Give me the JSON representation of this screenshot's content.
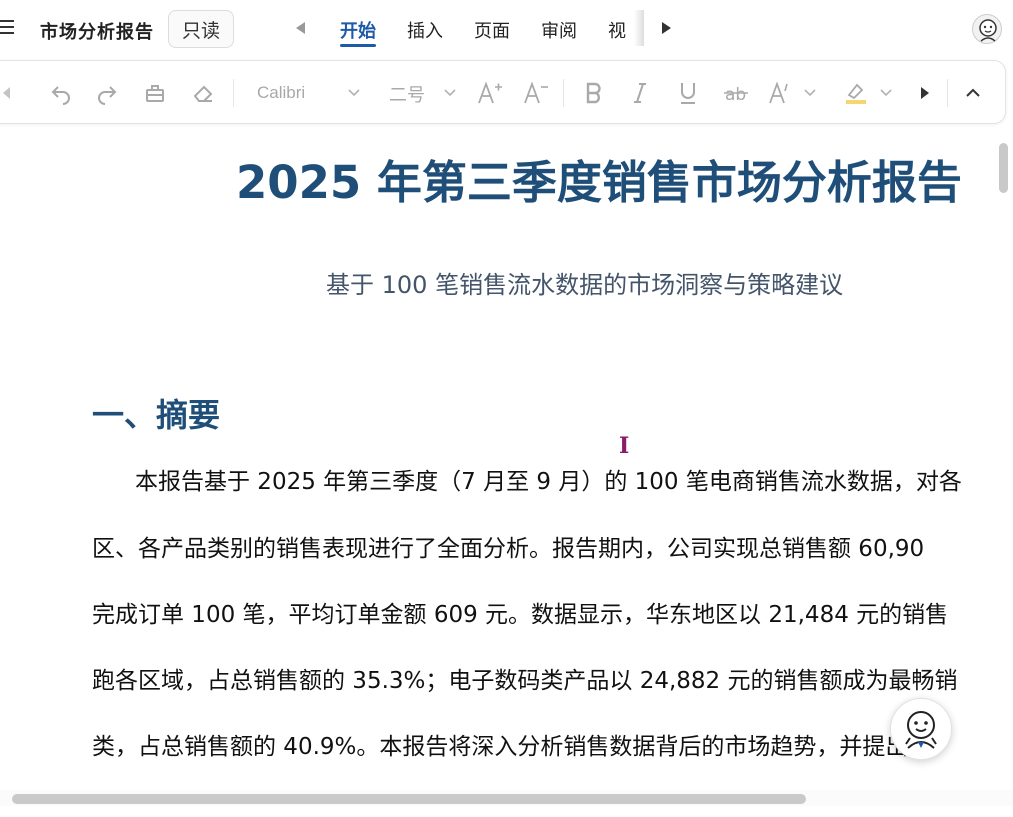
{
  "header": {
    "doc_title": "市场分析报告",
    "readonly_label": "只读",
    "tabs": [
      {
        "label": "开始",
        "active": true
      },
      {
        "label": "插入",
        "active": false
      },
      {
        "label": "页面",
        "active": false
      },
      {
        "label": "审阅",
        "active": false
      },
      {
        "label": "视",
        "active": false
      }
    ]
  },
  "toolbar": {
    "font_name": "Calibri",
    "font_size": "二号",
    "icons": [
      "undo-icon",
      "redo-icon",
      "format-painter-icon",
      "eraser-icon",
      "increase-font-icon",
      "decrease-font-icon",
      "bold-icon",
      "italic-icon",
      "underline-icon",
      "strikethrough-icon",
      "text-effect-icon",
      "highlight-icon",
      "more-icon",
      "collapse-icon"
    ]
  },
  "document": {
    "title": "2025 年第三季度销售市场分析报告",
    "subtitle": "基于 100 笔销售流水数据的市场洞察与策略建议",
    "section1_title": "一、摘要",
    "paragraph_lines": [
      "本报告基于 2025 年第三季度（7 月至 9 月）的 100 笔电商销售流水数据，对各",
      "区、各产品类别的销售表现进行了全面分析。报告期内，公司实现总销售额 60,90",
      "完成订单 100 笔，平均订单金额 609 元。数据显示，华东地区以 21,484 元的销售",
      "跑各区域，占总销售额的 35.3%；电子数码类产品以 24,882 元的销售额成为最畅销",
      "类，占总销售额的 40.9%。本报告将深入分析销售数据背后的市场趋势，并提出针"
    ]
  },
  "colors": {
    "accent": "#1e5aa8",
    "heading": "#1f4e79",
    "subtitle": "#44546a"
  }
}
